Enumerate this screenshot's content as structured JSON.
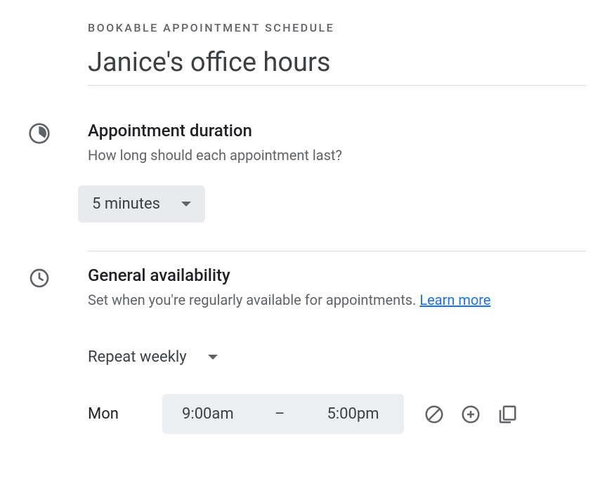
{
  "header": {
    "overline": "BOOKABLE APPOINTMENT SCHEDULE",
    "title": "Janice's office hours"
  },
  "duration": {
    "title": "Appointment duration",
    "desc": "How long should each appointment last?",
    "selected": "5 minutes"
  },
  "availability": {
    "title": "General availability",
    "desc": "Set when you're regularly available for appointments. ",
    "learn_more": "Learn more",
    "repeat": "Repeat weekly",
    "days": [
      {
        "label": "Mon",
        "start": "9:00am",
        "end": "5:00pm"
      }
    ]
  }
}
